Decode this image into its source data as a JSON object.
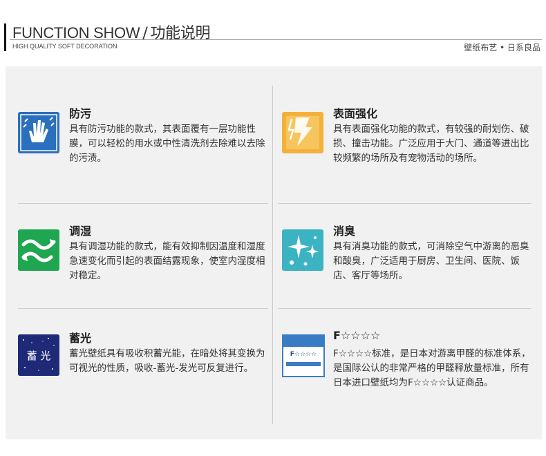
{
  "header": {
    "title_en": "FUNCTION SHOW",
    "separator": "/",
    "title_cn": "功能说明",
    "subtitle": "HIGH QUALITY SOFT DECORATION",
    "brand_right": "壁纸布艺 • 日系良品"
  },
  "features": [
    {
      "title": "防污",
      "icon": "hand-wipe-icon",
      "color": "#2b6fbf",
      "desc": "具有防污功能的款式，其表面覆有一层功能性膜，可以轻松的用水或中性清洗剂去除难以去除的污渍。"
    },
    {
      "title": "表面强化",
      "icon": "lightning-shield-icon",
      "color": "#f2a71b",
      "desc": "具有表面强化功能的款式，有较强的耐划伤、破损、撞击功能。广泛应用于大门、通道等进出比较频繁的场所及有宠物活动的场所。"
    },
    {
      "title": "调湿",
      "icon": "humidity-waves-icon",
      "color": "#1fa650",
      "desc": "具有调湿功能的款式，能有效抑制因温度和湿度急速变化而引起的表面结露现象，使室内湿度相对稳定。"
    },
    {
      "title": "消臭",
      "icon": "sparkle-deodorize-icon",
      "color": "#3bb3c3",
      "desc": "具有消臭功能的款式，可消除空气中游离的恶臭和酸臭，广泛适用于厨房、卫生间、医院、饭店、客厅等场所。"
    },
    {
      "title": "蓄光",
      "icon": "glow-stars-icon",
      "color": "#1e2a78",
      "icon_text": "蓄 光",
      "desc": "蓄光壁纸具有吸收积蓄光能，在暗处将其变换为可视光的性质，吸收-蓄光-发光可反复进行。"
    },
    {
      "title": "F☆☆☆☆",
      "icon": "f-star-certificate-icon",
      "color": "#3a7cc4",
      "icon_text": "F☆☆☆☆",
      "desc": "F☆☆☆☆标准，是日本对游离甲醛的标准体系，是国际公认的非常严格的甲醛释放量标准，所有日本进口壁纸均为F☆☆☆☆认证商品。"
    }
  ]
}
